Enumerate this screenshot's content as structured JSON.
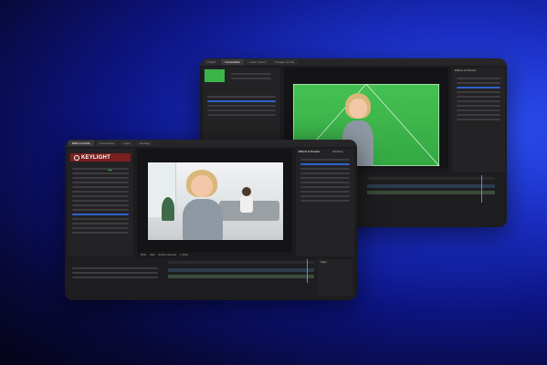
{
  "back_window": {
    "tabs": [
      {
        "label": "Project",
        "active": false
      },
      {
        "label": "Composition",
        "active": true
      },
      {
        "label": "Layer: (none)",
        "active": false
      },
      {
        "label": "Footage: (none)",
        "active": false
      }
    ],
    "effects_tab": "Effects & Presets",
    "magnify": "100%",
    "quality": "Full",
    "camera": "Active Camera",
    "view": "1 View"
  },
  "front_window": {
    "tabs": [
      {
        "label": "Effect Controls",
        "active": true
      },
      {
        "label": "Composition",
        "active": false
      },
      {
        "label": "Layer",
        "active": false
      },
      {
        "label": "Footage",
        "active": false
      }
    ],
    "effects_tabs": [
      {
        "label": "Effects & Presets",
        "active": true
      },
      {
        "label": "Libraries",
        "active": false
      }
    ],
    "plugin_logo": "KEYLIGHT",
    "magnify": "50%",
    "quality": "Half",
    "camera": "Active Camera",
    "view": "1 View",
    "align_label": "Align"
  },
  "colors": {
    "green_screen": "#3bb54a",
    "accent_blue": "#2f62c9",
    "logo_red": "#7a1f1f"
  }
}
